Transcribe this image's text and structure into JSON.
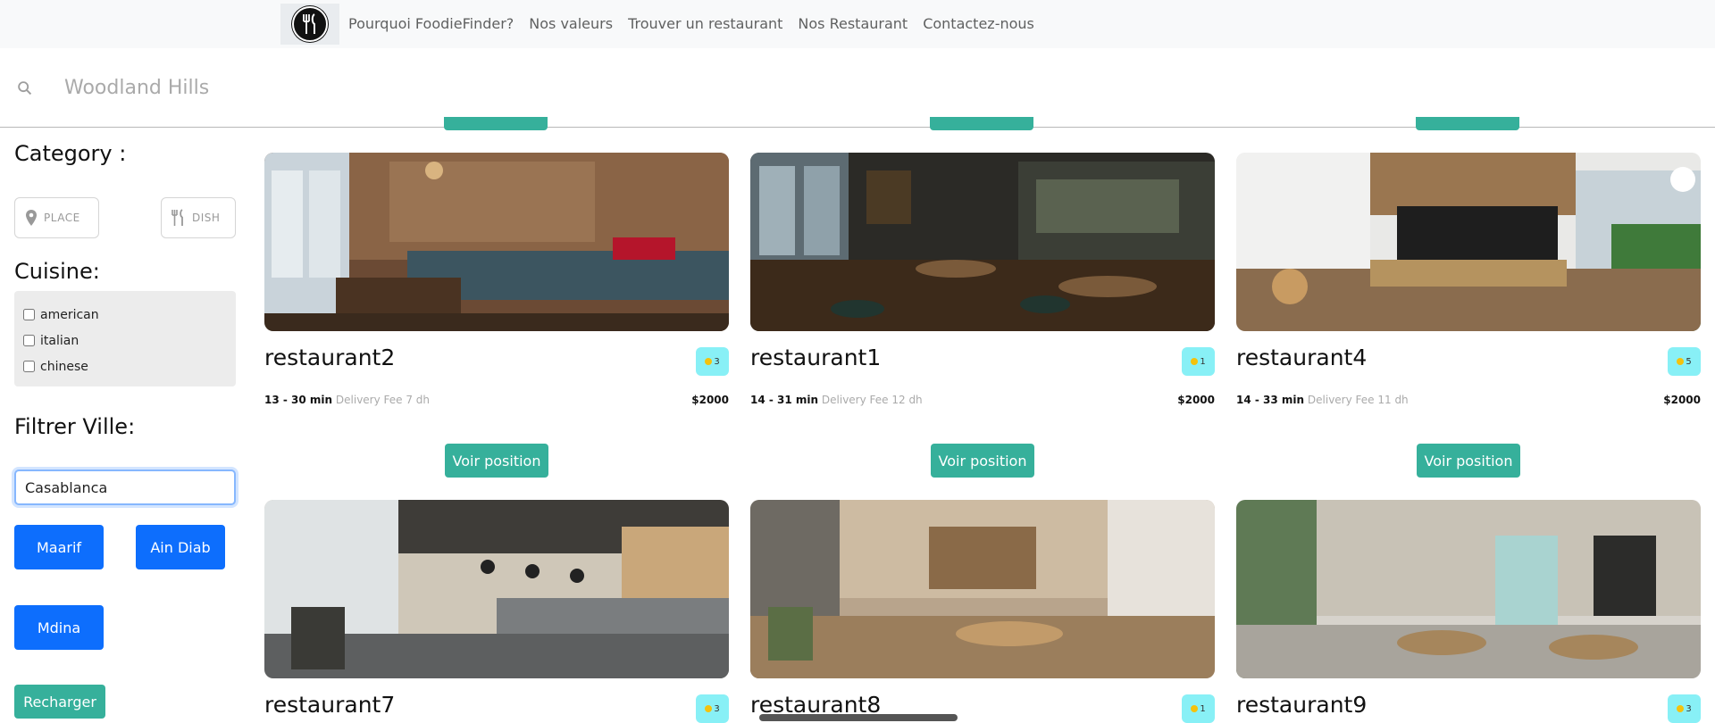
{
  "nav": {
    "items": [
      "Pourquoi FoodieFinder?",
      "Nos valeurs",
      "Trouver un restaurant",
      "Nos Restaurant",
      "Contactez-nous"
    ]
  },
  "search": {
    "placeholder": "Woodland Hills",
    "icon": "search-icon"
  },
  "sidebar": {
    "category_heading": "Category :",
    "place_chip": "PLACE",
    "dish_chip": "DISH",
    "cuisine_heading": "Cuisine:",
    "cuisines": [
      "american",
      "italian",
      "chinese"
    ],
    "ville_heading": "Filtrer Ville:",
    "ville_value": "Casablanca",
    "city_buttons": [
      "Maarif",
      "Ain Diab",
      "Mdina"
    ],
    "reload_label": "Recharger"
  },
  "voir_label": "Voir position",
  "restaurants": [
    {
      "name": "restaurant2",
      "rating": "3",
      "time": "13 - 30 min",
      "fee": "Delivery Fee 7 dh",
      "price": "$2000"
    },
    {
      "name": "restaurant1",
      "rating": "1",
      "time": "14 - 31 min",
      "fee": "Delivery Fee 12 dh",
      "price": "$2000"
    },
    {
      "name": "restaurant4",
      "rating": "5",
      "time": "14 - 33 min",
      "fee": "Delivery Fee 11 dh",
      "price": "$2000"
    },
    {
      "name": "restaurant7",
      "rating": "3"
    },
    {
      "name": "restaurant8",
      "rating": "1"
    },
    {
      "name": "restaurant9",
      "rating": "3"
    }
  ],
  "colors": {
    "accent": "#36b09b",
    "primary": "#0d6efd",
    "rating_bg": "#88f0f6"
  }
}
